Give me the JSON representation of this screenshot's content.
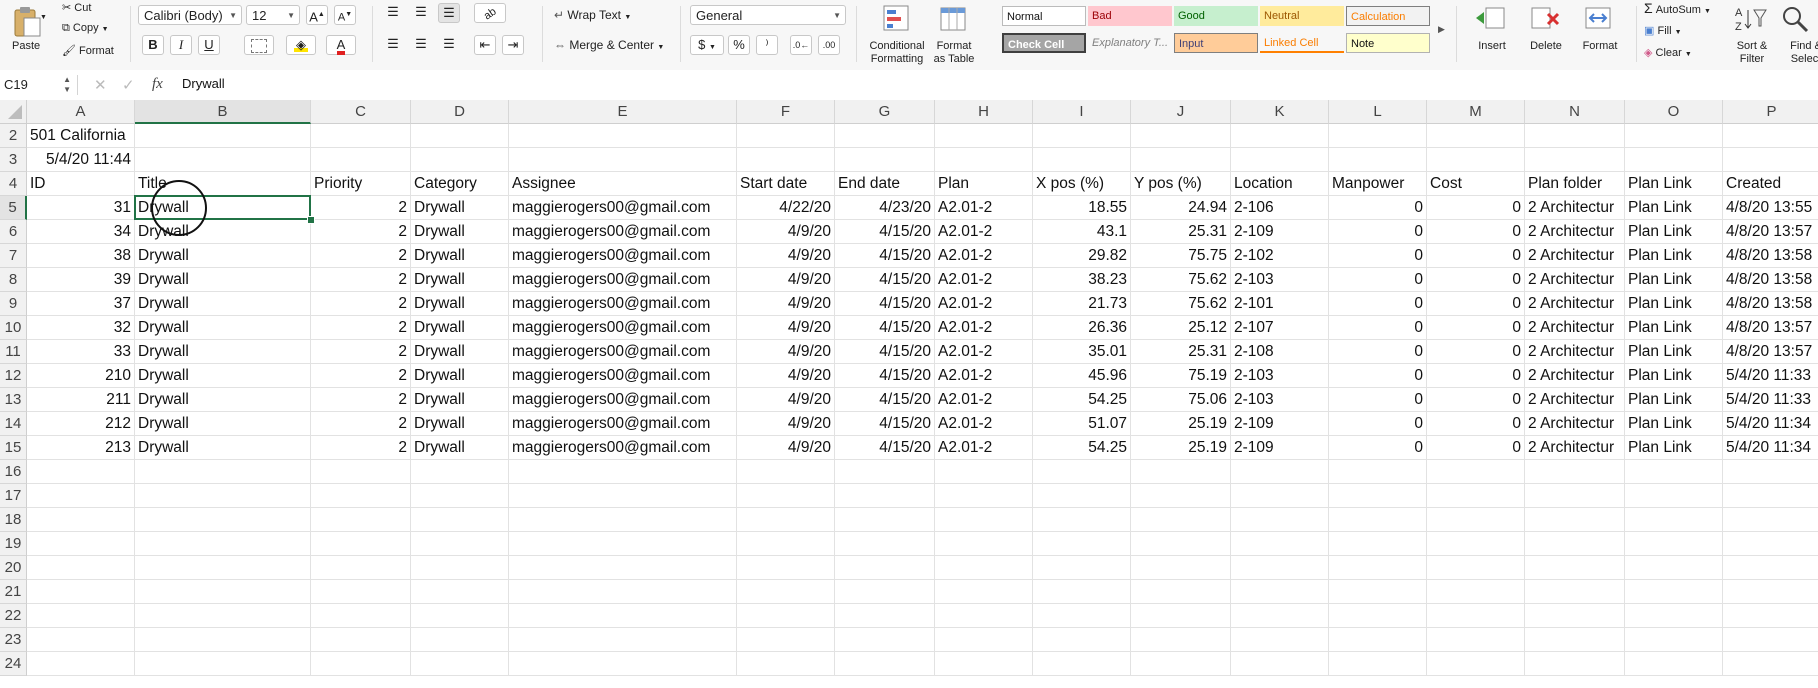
{
  "ribbon": {
    "paste": "Paste",
    "cut": "Cut",
    "copy": "Copy",
    "format_painter": "Format",
    "font_name": "Calibri (Body)",
    "font_size": "12",
    "wrap_text": "Wrap Text",
    "merge_center": "Merge & Center",
    "number_format": "General",
    "conditional_formatting": "Conditional\nFormatting",
    "format_as_table": "Format\nas Table",
    "styles": {
      "normal": "Normal",
      "bad": "Bad",
      "good": "Good",
      "neutral": "Neutral",
      "calculation": "Calculation",
      "check_cell": "Check Cell",
      "explanatory": "Explanatory T...",
      "input": "Input",
      "linked_cell": "Linked Cell",
      "note": "Note"
    },
    "insert": "Insert",
    "delete": "Delete",
    "format": "Format",
    "autosum": "AutoSum",
    "fill": "Fill",
    "clear": "Clear",
    "sort_filter": "Sort &\nFilter",
    "find_select": "Find &\nSelect"
  },
  "formula_bar": {
    "name_box": "C19",
    "fx": "fx",
    "formula": "Drywall"
  },
  "grid": {
    "columns": [
      "A",
      "B",
      "C",
      "D",
      "E",
      "F",
      "G",
      "H",
      "I",
      "J",
      "K",
      "L",
      "M",
      "N",
      "O",
      "P"
    ],
    "row_numbers": [
      "2",
      "3",
      "4",
      "5",
      "6",
      "7",
      "8",
      "9",
      "10",
      "11",
      "12",
      "13",
      "14",
      "15",
      "16",
      "17",
      "18",
      "19",
      "20",
      "21",
      "22",
      "23",
      "24"
    ],
    "row_2_a": "501 California",
    "row_3_a": "5/4/20 11:44",
    "headers": [
      "ID",
      "Title",
      "Priority",
      "Category",
      "Assignee",
      "Start date",
      "End date",
      "Plan",
      "X pos (%)",
      "Y pos (%)",
      "Location",
      "Manpower",
      "Cost",
      "Plan folder",
      "Plan Link",
      "Created"
    ],
    "rows": [
      [
        "31",
        "Drywall",
        "2",
        "Drywall",
        "maggierogers00@gmail.com",
        "4/22/20",
        "4/23/20",
        "A2.01-2",
        "18.55",
        "24.94",
        "2-106",
        "0",
        "0",
        "2 Architectur",
        "Plan Link",
        "4/8/20 13:55"
      ],
      [
        "34",
        "Drywall",
        "2",
        "Drywall",
        "maggierogers00@gmail.com",
        "4/9/20",
        "4/15/20",
        "A2.01-2",
        "43.1",
        "25.31",
        "2-109",
        "0",
        "0",
        "2 Architectur",
        "Plan Link",
        "4/8/20 13:57"
      ],
      [
        "38",
        "Drywall",
        "2",
        "Drywall",
        "maggierogers00@gmail.com",
        "4/9/20",
        "4/15/20",
        "A2.01-2",
        "29.82",
        "75.75",
        "2-102",
        "0",
        "0",
        "2 Architectur",
        "Plan Link",
        "4/8/20 13:58"
      ],
      [
        "39",
        "Drywall",
        "2",
        "Drywall",
        "maggierogers00@gmail.com",
        "4/9/20",
        "4/15/20",
        "A2.01-2",
        "38.23",
        "75.62",
        "2-103",
        "0",
        "0",
        "2 Architectur",
        "Plan Link",
        "4/8/20 13:58"
      ],
      [
        "37",
        "Drywall",
        "2",
        "Drywall",
        "maggierogers00@gmail.com",
        "4/9/20",
        "4/15/20",
        "A2.01-2",
        "21.73",
        "75.62",
        "2-101",
        "0",
        "0",
        "2 Architectur",
        "Plan Link",
        "4/8/20 13:58"
      ],
      [
        "32",
        "Drywall",
        "2",
        "Drywall",
        "maggierogers00@gmail.com",
        "4/9/20",
        "4/15/20",
        "A2.01-2",
        "26.36",
        "25.12",
        "2-107",
        "0",
        "0",
        "2 Architectur",
        "Plan Link",
        "4/8/20 13:57"
      ],
      [
        "33",
        "Drywall",
        "2",
        "Drywall",
        "maggierogers00@gmail.com",
        "4/9/20",
        "4/15/20",
        "A2.01-2",
        "35.01",
        "25.31",
        "2-108",
        "0",
        "0",
        "2 Architectur",
        "Plan Link",
        "4/8/20 13:57"
      ],
      [
        "210",
        "Drywall",
        "2",
        "Drywall",
        "maggierogers00@gmail.com",
        "4/9/20",
        "4/15/20",
        "A2.01-2",
        "45.96",
        "75.19",
        "2-103",
        "0",
        "0",
        "2 Architectur",
        "Plan Link",
        "5/4/20 11:33"
      ],
      [
        "211",
        "Drywall",
        "2",
        "Drywall",
        "maggierogers00@gmail.com",
        "4/9/20",
        "4/15/20",
        "A2.01-2",
        "54.25",
        "75.06",
        "2-103",
        "0",
        "0",
        "2 Architectur",
        "Plan Link",
        "5/4/20 11:33"
      ],
      [
        "212",
        "Drywall",
        "2",
        "Drywall",
        "maggierogers00@gmail.com",
        "4/9/20",
        "4/15/20",
        "A2.01-2",
        "51.07",
        "25.19",
        "2-109",
        "0",
        "0",
        "2 Architectur",
        "Plan Link",
        "5/4/20 11:34"
      ],
      [
        "213",
        "Drywall",
        "2",
        "Drywall",
        "maggierogers00@gmail.com",
        "4/9/20",
        "4/15/20",
        "A2.01-2",
        "54.25",
        "25.19",
        "2-109",
        "0",
        "0",
        "2 Architectur",
        "Plan Link",
        "5/4/20 11:34"
      ]
    ]
  }
}
